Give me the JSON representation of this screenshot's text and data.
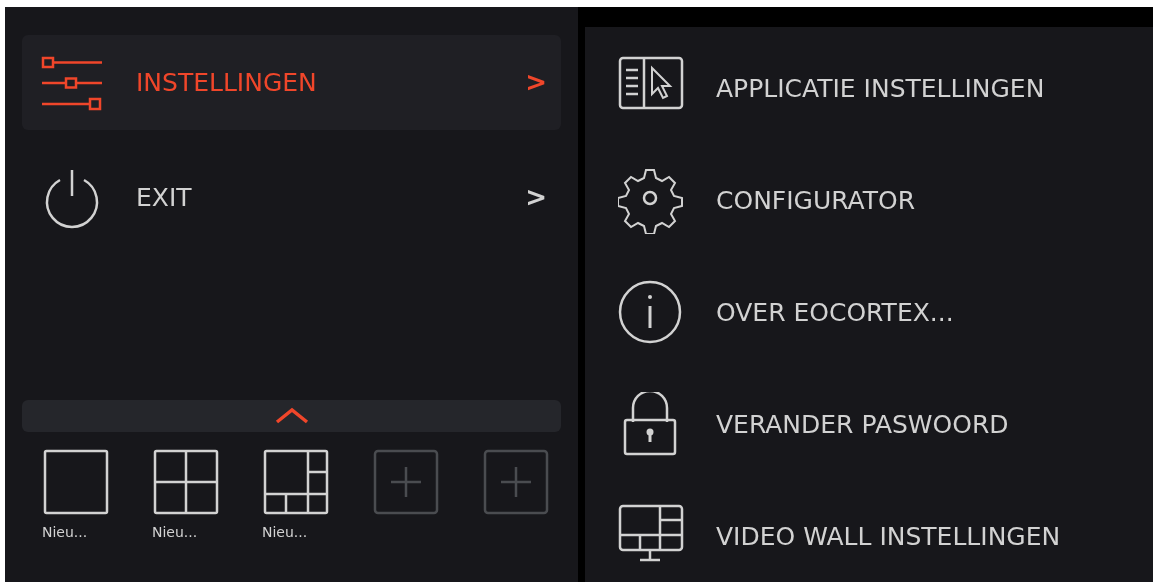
{
  "main_menu": [
    {
      "label": "INSTELLINGEN",
      "arrow": ">",
      "selected": true
    },
    {
      "label": "EXIT",
      "arrow": ">",
      "selected": false
    }
  ],
  "layouts_panel": {
    "expanded": false,
    "layouts": [
      {
        "kind": "single",
        "label": "Nieu..."
      },
      {
        "kind": "quad",
        "label": "Nieu..."
      },
      {
        "kind": "multi",
        "label": "Nieu..."
      },
      {
        "kind": "add"
      },
      {
        "kind": "add"
      }
    ]
  },
  "submenu": [
    {
      "label": "APPLICATIE INSTELLINGEN"
    },
    {
      "label": "CONFIGURATOR"
    },
    {
      "label": "OVER EOCORTEX..."
    },
    {
      "label": "VERANDER PASWOORD"
    },
    {
      "label": "VIDEO WALL INSTELLINGEN"
    }
  ]
}
